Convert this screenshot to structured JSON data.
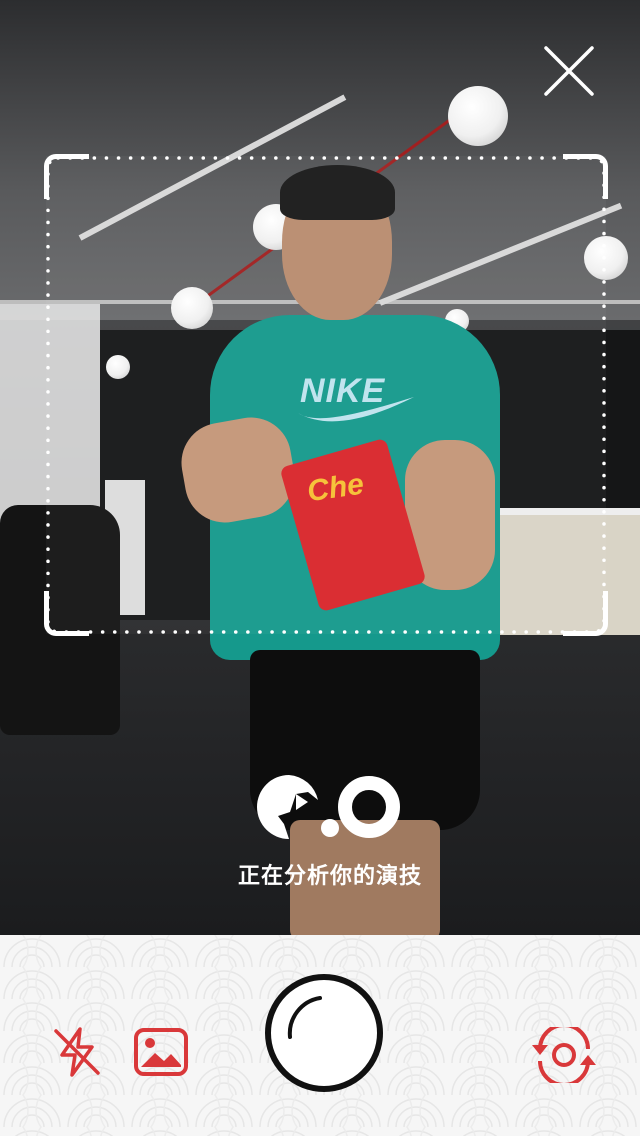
{
  "status": {
    "analyzing_text": "正在分析你的演技"
  },
  "scene": {
    "shirt_brand": "NIKE",
    "snack_brand": "Che"
  },
  "colors": {
    "accent": "#d9383a",
    "frame": "#ffffff",
    "toolbar_bg": "#f6f6f6"
  },
  "icons": {
    "close": "close-icon",
    "analyze": "analyze-face-icon",
    "flash_off": "flash-off-icon",
    "gallery": "gallery-image-icon",
    "shutter": "shutter-icon",
    "flip_camera": "flip-camera-icon"
  }
}
